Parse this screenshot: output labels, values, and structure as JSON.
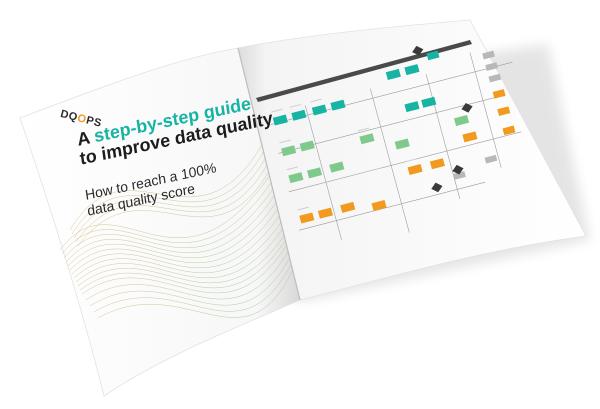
{
  "brochure": {
    "logo": {
      "prefix": "DQ",
      "mid": "O",
      "suffix": "PS"
    },
    "headline": {
      "lead": "A ",
      "highlight": "step-by-step guide",
      "line2": "to improve data quality"
    },
    "subline": {
      "line1": "How to reach a 100%",
      "line2": "data quality score"
    }
  },
  "colors": {
    "accent_teal": "#17b3a3",
    "accent_orange": "#f29a1f",
    "accent_green": "#7fc98c",
    "diamond_dark": "#3a3a3a",
    "page": "#ffffff",
    "shadow": "#d9d9d9"
  }
}
